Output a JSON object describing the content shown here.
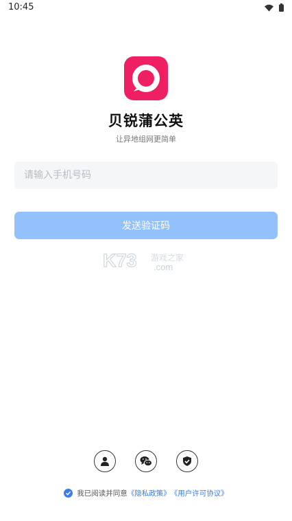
{
  "status_bar": {
    "time": "10:45"
  },
  "app": {
    "name": "贝锐蒲公英",
    "tagline": "让异地组网更简单",
    "brand_color": "#ee1f63"
  },
  "login": {
    "phone_placeholder": "请输入手机号码",
    "send_code_label": "发送验证码",
    "button_color": "#93c1fd"
  },
  "watermark": {
    "text": "K73",
    "suffix": ".com",
    "site": "游戏之家"
  },
  "social_login": [
    {
      "name": "account-login",
      "icon": "person-icon"
    },
    {
      "name": "wechat-login",
      "icon": "wechat-icon"
    },
    {
      "name": "security-login",
      "icon": "shield-icon"
    }
  ],
  "agreement": {
    "checked": true,
    "prefix": "我已阅读并同意",
    "privacy_link": "《隐私政策》",
    "terms_link": "《用户许可协议》",
    "accent_color": "#3a7cf0"
  }
}
